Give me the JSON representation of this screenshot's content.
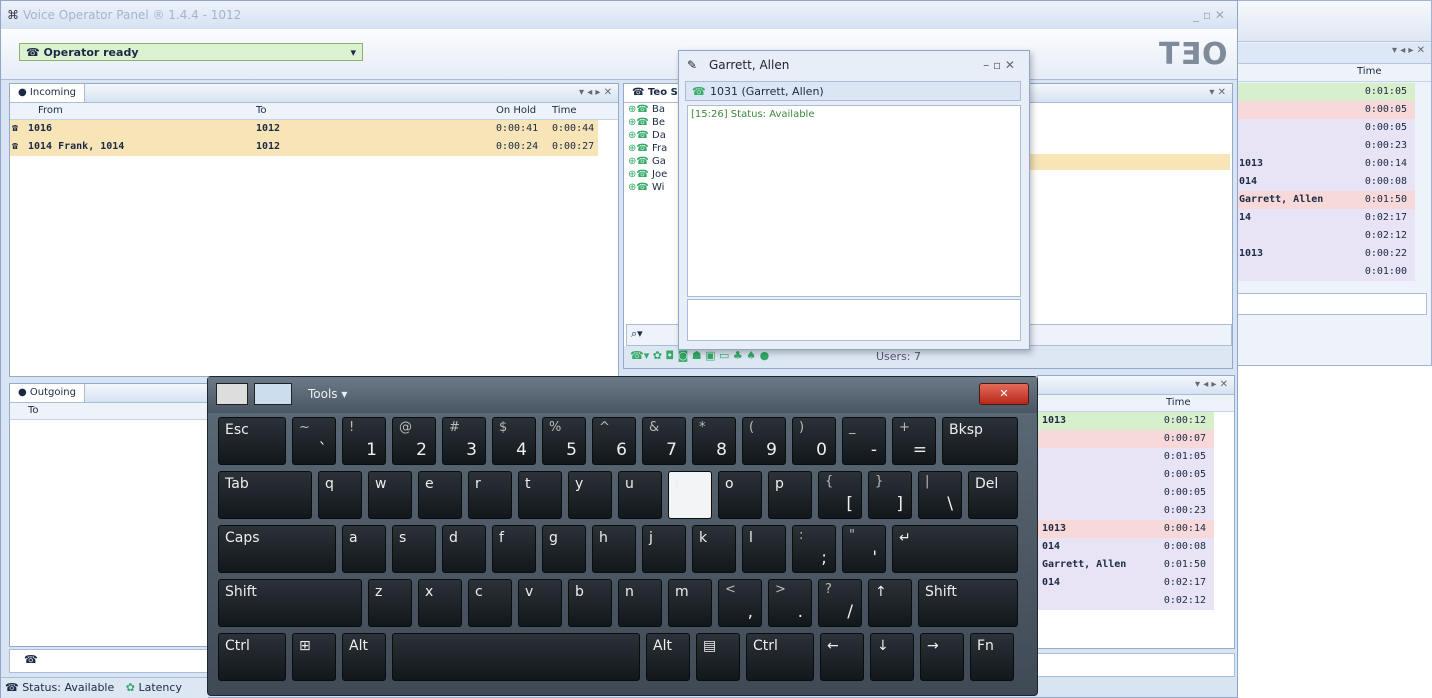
{
  "window": {
    "title": "Voice Operator Panel ® 1.4.4 - 1012",
    "logo": "TƎO"
  },
  "operator": {
    "status": "Operator ready"
  },
  "incoming": {
    "tab": "Incoming",
    "columns": [
      "From",
      "To",
      "On Hold",
      "Time"
    ],
    "rows": [
      {
        "from": "1016",
        "to": "1012",
        "hold": "0:00:41",
        "time": "0:00:44"
      },
      {
        "from": "1014 Frank, 1014",
        "to": "1012",
        "hold": "0:00:24",
        "time": "0:00:27"
      }
    ]
  },
  "teo": {
    "tab": "Teo S",
    "items": [
      "Ba",
      "Be",
      "Da",
      "Fra",
      "Ga",
      "Joe",
      "Wi"
    ],
    "users": "Users: 7"
  },
  "chat": {
    "title": "Garrett, Allen",
    "contact": "1031 (Garrett, Allen)",
    "message": "[15:26] Status: Available"
  },
  "outgoing": {
    "tab": "Outgoing",
    "col": "To"
  },
  "right_panel": {
    "time_header": "Time",
    "rows": [
      {
        "name": "",
        "time": "0:01:05"
      },
      {
        "name": "",
        "time": "0:00:05"
      },
      {
        "name": "",
        "time": "0:00:05"
      },
      {
        "name": "",
        "time": "0:00:23"
      },
      {
        "name": "1013",
        "time": "0:00:14"
      },
      {
        "name": "014",
        "time": "0:00:08"
      },
      {
        "name": "Garrett, Allen",
        "time": "0:01:50"
      },
      {
        "name": "14",
        "time": "0:02:17"
      },
      {
        "name": "",
        "time": "0:02:12"
      },
      {
        "name": "1013",
        "time": "0:00:22"
      },
      {
        "name": "",
        "time": "0:01:00"
      }
    ]
  },
  "right_panel_lower": {
    "time_header": "Time",
    "rows": [
      {
        "name": "1013",
        "time": "0:00:12"
      },
      {
        "name": "",
        "time": "0:00:07"
      },
      {
        "name": "",
        "time": "0:01:05"
      },
      {
        "name": "",
        "time": "0:00:05"
      },
      {
        "name": "",
        "time": "0:00:05"
      },
      {
        "name": "",
        "time": "0:00:23"
      },
      {
        "name": "1013",
        "time": "0:00:14"
      },
      {
        "name": "014",
        "time": "0:00:08"
      },
      {
        "name": "Garrett, Allen",
        "time": "0:01:50"
      },
      {
        "name": "014",
        "time": "0:02:17"
      },
      {
        "name": "",
        "time": "0:02:12"
      }
    ]
  },
  "keyboard": {
    "tools": "Tools"
  },
  "statusbar": {
    "status": "Status: Available",
    "latency": "Latency"
  }
}
